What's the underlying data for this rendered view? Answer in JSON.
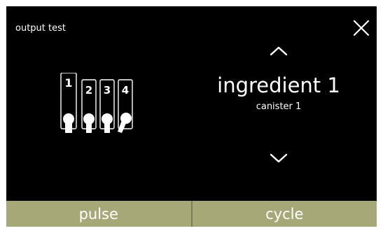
{
  "screen": {
    "title": "output test"
  },
  "selector": {
    "ingredient": "ingredient 1",
    "canister": "canister 1"
  },
  "dispensers": {
    "labels": [
      "1",
      "2",
      "3",
      "4"
    ],
    "selected": "1"
  },
  "footer": {
    "pulse_label": "pulse",
    "cycle_label": "cycle"
  },
  "icons": {
    "close": "close-icon",
    "up": "chevron-up-icon",
    "down": "chevron-down-icon"
  },
  "colors": {
    "background": "#000000",
    "text": "#ffffff",
    "footer": "#a6a878"
  }
}
